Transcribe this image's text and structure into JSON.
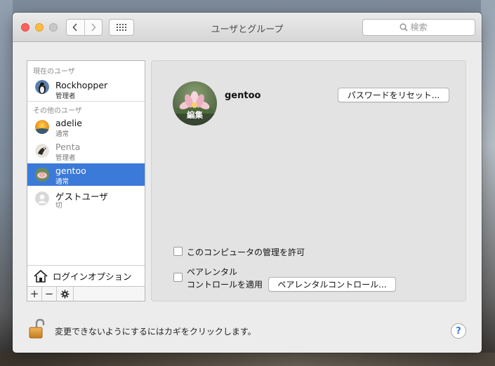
{
  "window": {
    "title": "ユーザとグループ",
    "search_placeholder": "検索"
  },
  "icons": {
    "back": "chevron-left-icon",
    "forward": "chevron-right-icon",
    "show_all": "grid-icon",
    "search": "magnifier-icon",
    "home": "house-icon",
    "add": "plus-icon",
    "remove": "minus-icon",
    "action": "gear-icon",
    "lock": "padlock-open-icon",
    "help": "question-icon"
  },
  "sidebar": {
    "current_header": "現在のユーザ",
    "current_user": {
      "name": "Rockhopper",
      "role": "管理者"
    },
    "other_header": "その他のユーザ",
    "users": [
      {
        "name": "adelie",
        "role": "通常"
      },
      {
        "name": "Penta",
        "role": "管理者"
      },
      {
        "name": "gentoo",
        "role": "通常",
        "selected": true
      },
      {
        "name": "ゲストユーザ",
        "role": "切"
      }
    ],
    "login_options": "ログインオプション",
    "add_symbol": "+",
    "remove_symbol": "−"
  },
  "detail": {
    "name": "gentoo",
    "avatar_edit": "編集",
    "reset_password": "パスワードをリセット...",
    "allow_admin": "このコンピュータの管理を許可",
    "allow_admin_checked": false,
    "parental_line1": "ペアレンタル",
    "parental_line2": "コントロールを適用",
    "parental_checked": false,
    "parental_button": "ペアレンタルコントロール..."
  },
  "footer": {
    "lock_text": "変更できないようにするにはカギをクリックします。",
    "help_symbol": "?"
  },
  "colors": {
    "selection": "#3b7ad9",
    "close": "#fc605c",
    "minimize": "#fdbc40"
  }
}
